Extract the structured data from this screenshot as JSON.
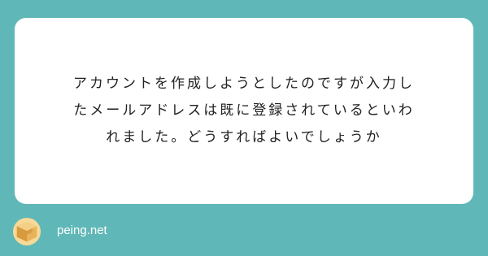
{
  "question": {
    "lines": [
      "アカウントを作成しようとしたのですが入力し",
      "たメールアドレスは既に登録されているといわ",
      "れました。どうすればよいでしょうか"
    ]
  },
  "footer": {
    "brand": "peing.net"
  },
  "colors": {
    "background": "#5fb8b7",
    "card": "#ffffff",
    "box_light": "#f4cf86",
    "box_dark": "#d99a3c"
  },
  "icons": {
    "logo": "cardboard-box-icon"
  }
}
